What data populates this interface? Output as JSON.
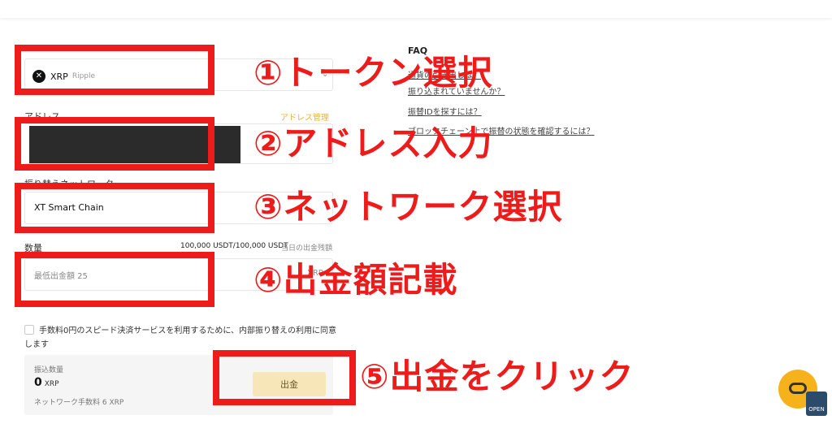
{
  "token": {
    "symbol": "XRP",
    "name": "Ripple",
    "icon": "xrp-logo-icon"
  },
  "labels": {
    "address": "アドレス",
    "address_manage": "アドレス管理",
    "network": "振り替えネットワーク",
    "amount": "数量",
    "limit": "100,000 USDT/100,000 USDT",
    "limit_note": "当日の出金残額",
    "min_amount": "最低出金額 25",
    "unit": "XRP"
  },
  "network": {
    "selected": "XT Smart Chain"
  },
  "faq": {
    "title": "FAQ",
    "links": [
      "通貨の引き出しは？",
      "振り込まれていませんか？",
      "振替IDを探すには？",
      "ブロックチェーン上で振替の状態を確認するには？"
    ]
  },
  "consent_text": "手数料0円のスピード決済サービスを利用するために、内部振り替えの利用に同意します",
  "summary": {
    "label": "振込数量",
    "value": "0",
    "unit": "XRP",
    "fee": "ネットワーク手数料 6 XRP",
    "button": "出金"
  },
  "annotations": {
    "step1": "①トークン選択",
    "step2": "②アドレス入力",
    "step3": "③ネットワーク選択",
    "step4": "④出金額記載",
    "step5": "⑤出金をクリック"
  },
  "widgets": {
    "open_badge": "OPEN",
    "chat_icon": "chat-bubble-icon"
  },
  "colors": {
    "annotation_red": "#ee1b1b",
    "accent_gold": "#e8b23a",
    "withdraw_button": "#f6e6b8"
  }
}
